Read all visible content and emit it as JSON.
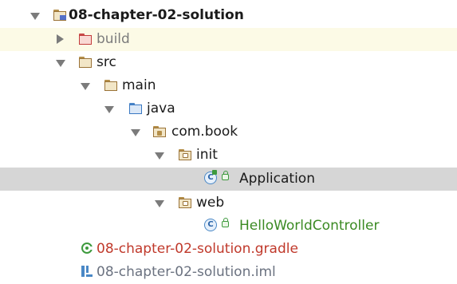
{
  "tree": {
    "root": {
      "label": "08-chapter-02-solution"
    },
    "build": {
      "label": "build"
    },
    "src": {
      "label": "src"
    },
    "main": {
      "label": "main"
    },
    "java": {
      "label": "java"
    },
    "pkg": {
      "label": "com.book"
    },
    "init": {
      "label": "init"
    },
    "application": {
      "label": "Application"
    },
    "web": {
      "label": "web"
    },
    "controller": {
      "label": "HelloWorldController"
    },
    "gradle_file": {
      "label": "08-chapter-02-solution.gradle"
    },
    "iml_file": {
      "label": "08-chapter-02-solution.iml"
    }
  },
  "colors": {
    "row_highlight": "#fcfae6",
    "row_selected": "#d6d6d6",
    "gradle_text": "#c0392b",
    "controller_text": "#3b8a23",
    "excluded_text": "#7c7c7c"
  },
  "icons": {
    "root": "project-folder-icon",
    "build": "excluded-folder-icon",
    "src": "folder-icon",
    "main": "folder-icon",
    "java": "source-root-folder-icon",
    "pkg": "package-icon",
    "init": "package-icon",
    "application": "runnable-class-icon",
    "web": "package-icon",
    "controller": "class-icon",
    "gradle_file": "gradle-icon",
    "iml_file": "iml-module-icon"
  }
}
